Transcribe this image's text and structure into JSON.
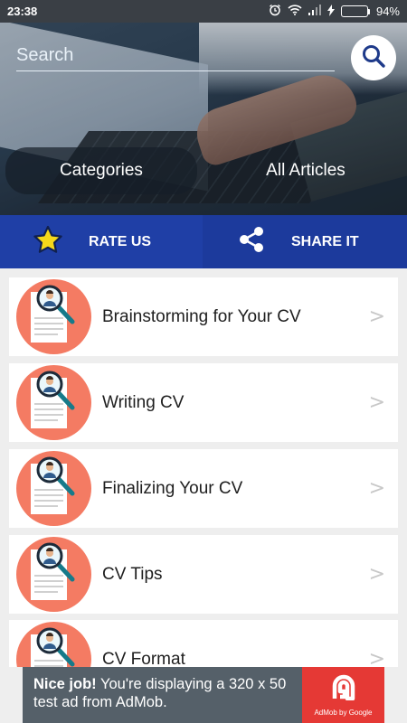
{
  "status_bar": {
    "time": "23:38",
    "battery": "94%",
    "battery_level": 0.94
  },
  "header": {
    "search": {
      "placeholder": "Search",
      "value": ""
    },
    "search_icon": "search-icon",
    "tabs": [
      {
        "label": "Categories",
        "active": true
      },
      {
        "label": "All Articles",
        "active": false
      }
    ]
  },
  "actions": {
    "rate": {
      "label": "RATE US",
      "icon": "star-icon"
    },
    "share": {
      "label": "SHARE IT",
      "icon": "share-icon"
    }
  },
  "list": {
    "items": [
      {
        "title": "Brainstorming for Your CV",
        "arrow": ">"
      },
      {
        "title": "Writing CV",
        "arrow": ">"
      },
      {
        "title": "Finalizing Your CV",
        "arrow": ">"
      },
      {
        "title": "CV Tips",
        "arrow": ">"
      },
      {
        "title": "CV Format",
        "arrow": ">"
      }
    ]
  },
  "ad": {
    "headline": "Nice job!",
    "body": "You're displaying a 320 x 50 test ad from AdMob.",
    "brand": "AdMob by Google"
  },
  "colors": {
    "action_bar": "#1f3fa6",
    "avatar": "#f47b63",
    "star": "#f5d81a",
    "ad_background": "#556069",
    "ad_logo": "#e53935"
  }
}
